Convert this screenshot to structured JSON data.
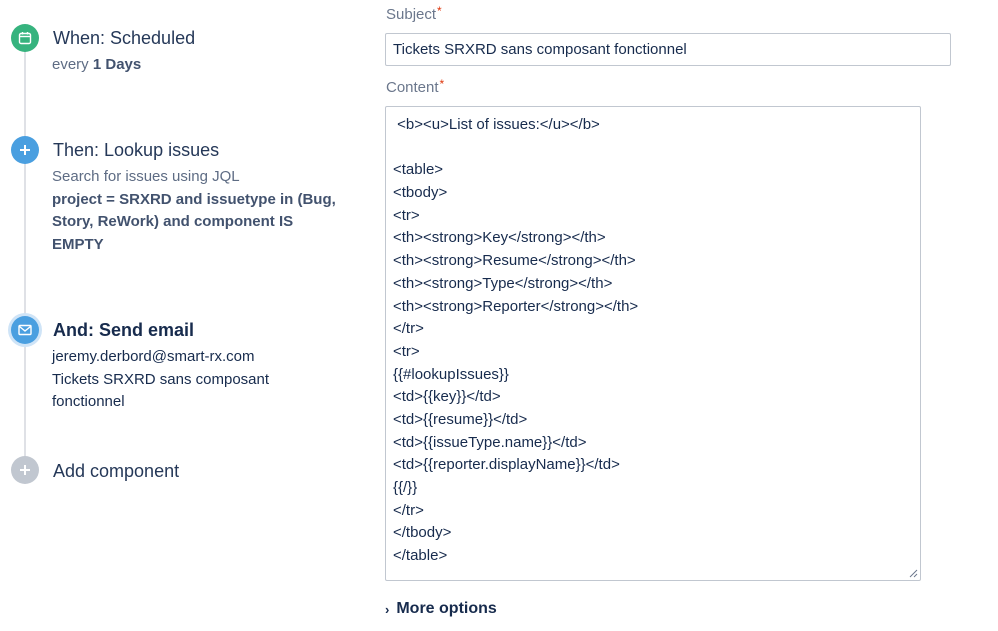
{
  "steps": {
    "trigger": {
      "title": "When: Scheduled",
      "detail_prefix": "every ",
      "detail_value": "1 Days"
    },
    "lookup": {
      "title": "Then: Lookup issues",
      "detail": "Search for issues using JQL",
      "jql": "project = SRXRD and issuetype in (Bug, Story, ReWork) and component IS EMPTY"
    },
    "email": {
      "title": "And: Send email",
      "to": "jeremy.derbord@smart-rx.com",
      "subject": "Tickets SRXRD sans composant fonctionnel"
    },
    "add": {
      "title": "Add component"
    }
  },
  "form": {
    "subject_label": "Subject",
    "subject_value": "Tickets SRXRD sans composant fonctionnel",
    "content_label": "Content",
    "required_mark": "*",
    "content_lines": [
      " <b><u>List of issues:</u></b>",
      "",
      "<table>",
      "<tbody>",
      "<tr>",
      "<th><strong>Key</strong></th>",
      "<th><strong>Resume</strong></th>",
      "<th><strong>Type</strong></th>",
      "<th><strong>Reporter</strong></th>",
      "</tr>",
      "<tr>",
      "{{#lookupIssues}}",
      "<td>{{key}}</td>",
      "<td>{{resume}}</td>",
      "<td>{{issueType.name}}</td>",
      "<td>{{reporter.displayName}}</td>",
      "{{/}}",
      "</tr>",
      "</tbody>",
      "</table>"
    ],
    "more_options": "More options"
  },
  "icons": {
    "trigger": "calendar-icon",
    "lookup": "plus-icon",
    "email": "envelope-icon",
    "add": "plus-icon"
  },
  "colors": {
    "trigger": "#36b37e",
    "action": "#4a9fe0",
    "add": "#c1c7d0",
    "required": "#de350b"
  }
}
